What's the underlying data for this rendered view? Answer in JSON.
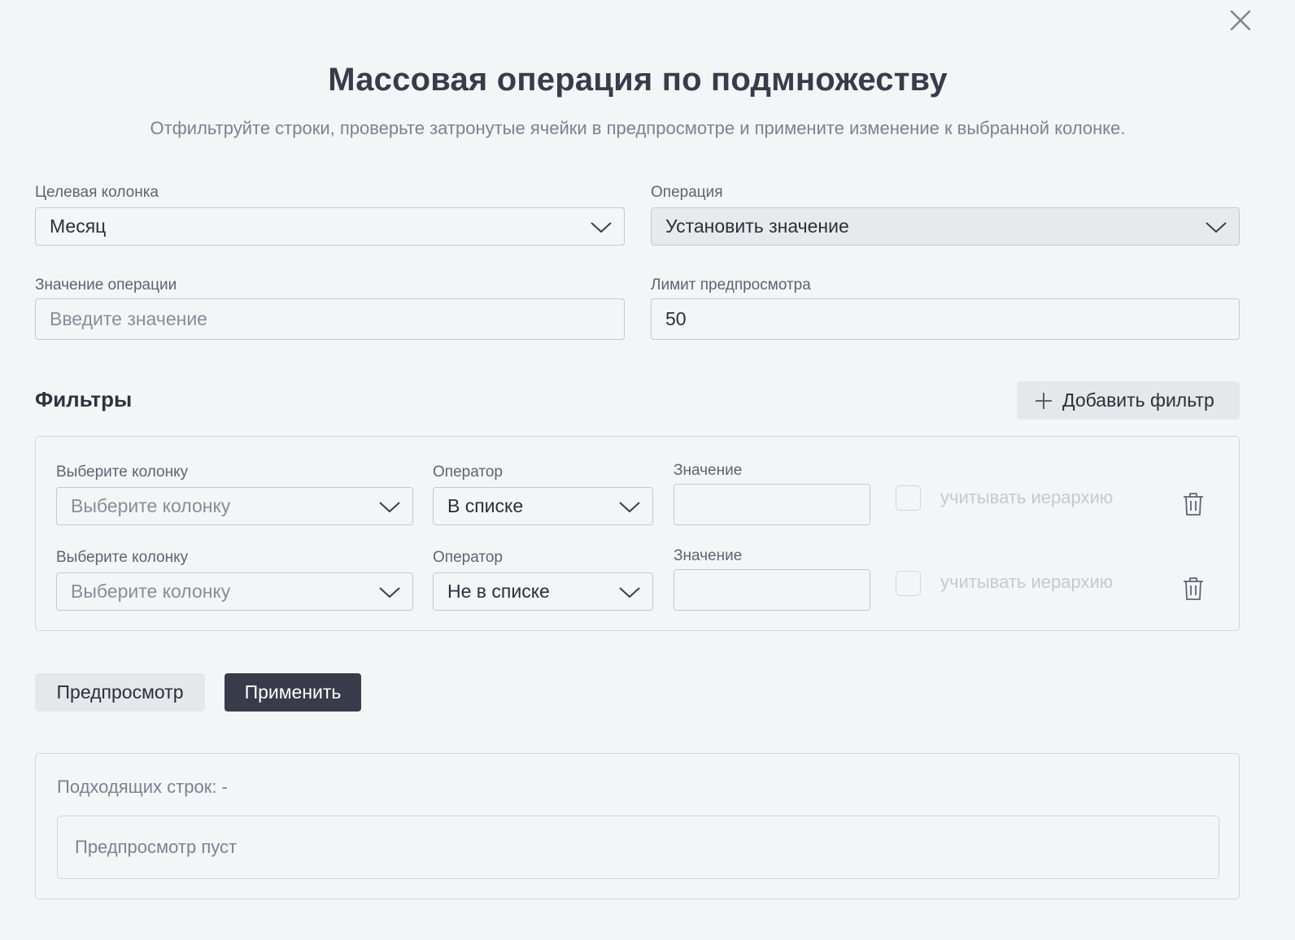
{
  "dialog": {
    "title": "Массовая операция по подмножеству",
    "subtitle": "Отфильтруйте строки, проверьте затронутые ячейки в предпросмотре и примените изменение к выбранной колонке.",
    "close_icon": "close-icon"
  },
  "form": {
    "target_column": {
      "label": "Целевая колонка",
      "value": "Месяц"
    },
    "operation": {
      "label": "Операция",
      "value": "Установить значение"
    },
    "operation_value": {
      "label": "Значение операции",
      "placeholder": "Введите значение",
      "value": ""
    },
    "preview_limit": {
      "label": "Лимит предпросмотра",
      "value": "50"
    }
  },
  "filters": {
    "title": "Фильтры",
    "add_label": "Добавить фильтр",
    "rows": [
      {
        "column_label": "Выберите колонку",
        "column_placeholder": "Выберите колонку",
        "operator_label": "Оператор",
        "operator_value": "В списке",
        "value_label": "Значение",
        "value": "",
        "hierarchy_label": "учитывать иерархию",
        "hierarchy_checked": false
      },
      {
        "column_label": "Выберите колонку",
        "column_placeholder": "Выберите колонку",
        "operator_label": "Оператор",
        "operator_value": "Не в списке",
        "value_label": "Значение",
        "value": "",
        "hierarchy_label": "учитывать иерархию",
        "hierarchy_checked": false
      }
    ]
  },
  "actions": {
    "preview_label": "Предпросмотр",
    "apply_label": "Применить"
  },
  "result": {
    "match_count": "Подходящих строк: -",
    "empty_text": "Предпросмотр пуст"
  },
  "colors": {
    "background": "#f4f5f7",
    "primary_button": "#383c4a",
    "secondary_button": "#e6e7ea",
    "border": "#c4c8cf"
  }
}
